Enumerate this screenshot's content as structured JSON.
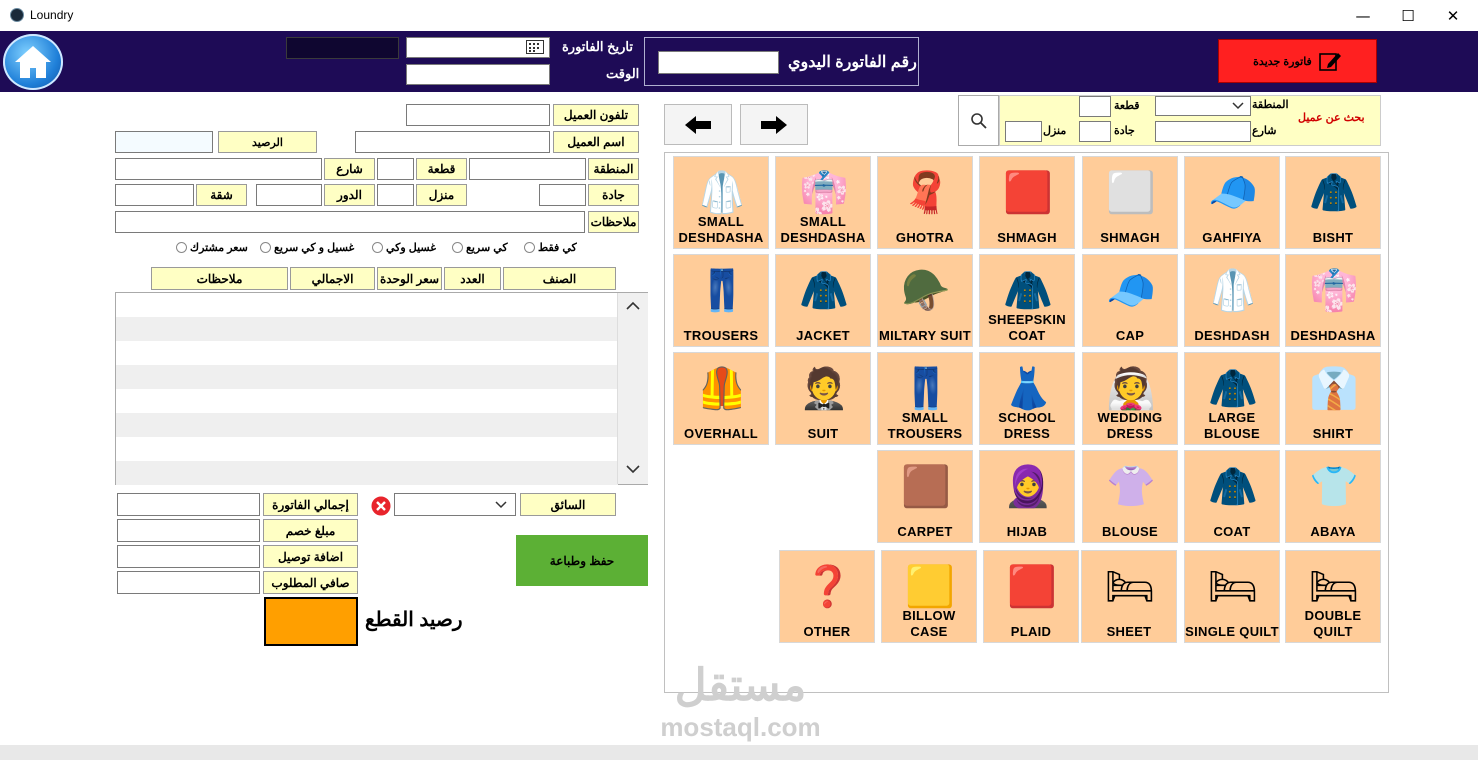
{
  "window": {
    "title": "Loundry",
    "minimize": "—",
    "maximize": "☐",
    "close": "✕"
  },
  "header": {
    "invoice_date_label": "تاريخ الفاتورة",
    "time_label": "الوقت",
    "manual_invoice_label": "رقم الفاتورة اليدوي",
    "new_invoice_label": "فاتورة جديدة"
  },
  "search": {
    "title": "بحث عن عميل",
    "region_label": "المنطقة",
    "street_label": "شارع",
    "block_label": "قطعة",
    "avenue_label": "جادة",
    "house_label": "منزل"
  },
  "customer": {
    "phone_label": "تلفون العميل",
    "name_label": "اسم العميل",
    "balance_label": "الرصيد",
    "region_label": "المنطقة",
    "block_label": "قطعة",
    "street_label": "شارع",
    "avenue_label": "جادة",
    "house_label": "منزل",
    "floor_label": "الدور",
    "apartment_label": "شقة",
    "notes_label": "ملاحظات"
  },
  "service_options": [
    "كي فقط",
    "كي سريع",
    "غسيل وكي",
    "غسيل و كي سريع",
    "سعر مشترك"
  ],
  "grid": {
    "columns": [
      "الصنف",
      "العدد",
      "سعر الوحدة",
      "الاجمالي",
      "ملاحظات"
    ]
  },
  "totals": {
    "driver_label": "السائق",
    "invoice_total_label": "إجمالي الفاتورة",
    "discount_label": "مبلغ خصم",
    "delivery_label": "اضافة توصيل",
    "net_label": "صافي المطلوب",
    "save_print_label": "حفظ وطباعة",
    "pieces_balance_label": "رصيد القطع"
  },
  "items_rows": [
    [
      {
        "label": "SMALL DESHDASHA",
        "icon": "🥼"
      },
      {
        "label": "SMALL DESHDASHA",
        "icon": "👘"
      },
      {
        "label": "GHOTRA",
        "icon": "🧣"
      },
      {
        "label": "SHMAGH",
        "icon": "🟥"
      },
      {
        "label": "SHMAGH",
        "icon": "⬜"
      },
      {
        "label": "GAHFIYA",
        "icon": "🧢"
      },
      {
        "label": "BISHT",
        "icon": "🧥"
      }
    ],
    [
      {
        "label": "TROUSERS",
        "icon": "👖"
      },
      {
        "label": "JACKET",
        "icon": "🧥"
      },
      {
        "label": "MILTARY SUIT",
        "icon": "🪖"
      },
      {
        "label": "SHEEPSKIN COAT",
        "icon": "🧥"
      },
      {
        "label": "CAP",
        "icon": "🧢"
      },
      {
        "label": "DESHDASH",
        "icon": "🥼"
      },
      {
        "label": "DESHDASHA",
        "icon": "👘"
      }
    ],
    [
      {
        "label": "OVERHALL",
        "icon": "🦺"
      },
      {
        "label": "SUIT",
        "icon": "🤵"
      },
      {
        "label": "SMALL TROUSERS",
        "icon": "👖"
      },
      {
        "label": "SCHOOL DRESS",
        "icon": "👗"
      },
      {
        "label": "WEDDING DRESS",
        "icon": "👰"
      },
      {
        "label": "LARGE BLOUSE",
        "icon": "🧥"
      },
      {
        "label": "SHIRT",
        "icon": "👔"
      }
    ],
    [
      {
        "label": "CARPET",
        "icon": "🟫"
      },
      {
        "label": "HIJAB",
        "icon": "🧕"
      },
      {
        "label": "BLOUSE",
        "icon": "👚"
      },
      {
        "label": "COAT",
        "icon": "🧥"
      },
      {
        "label": "ABAYA",
        "icon": "👕"
      }
    ],
    [
      {
        "label": "OTHER",
        "icon": "❓"
      },
      {
        "label": "BILLOW CASE",
        "icon": "🟨"
      },
      {
        "label": "PLAID",
        "icon": "🟥"
      },
      {
        "label": "SHEET",
        "icon": "🛏"
      },
      {
        "label": "SINGLE QUILT",
        "icon": "🛏"
      },
      {
        "label": "DOUBLE QUILT",
        "icon": "🛏"
      }
    ]
  ],
  "watermark": {
    "arabic": "مستقل",
    "latin": "mostaql.com"
  }
}
